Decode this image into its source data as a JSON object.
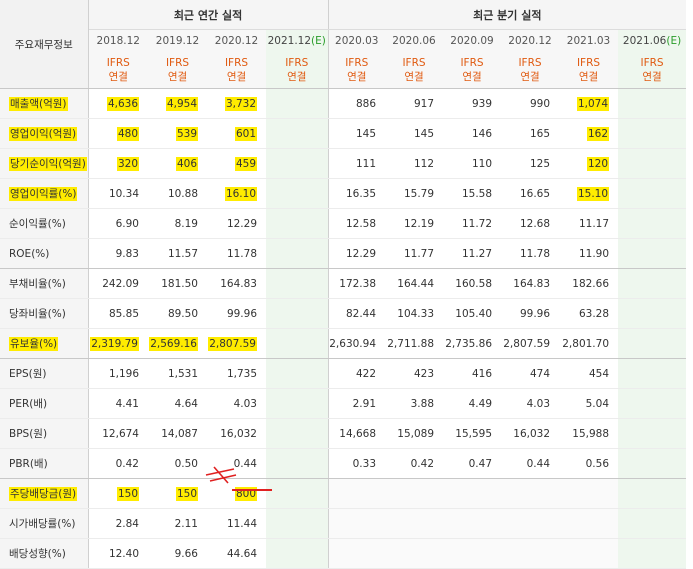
{
  "corner_label": "주요재무정보",
  "annual_header": "최근 연간 실적",
  "quarter_header": "최근 분기 실적",
  "annual_periods": [
    {
      "period": "2018.12",
      "std": "IFRS",
      "basis": "연결",
      "estimate": false
    },
    {
      "period": "2019.12",
      "std": "IFRS",
      "basis": "연결",
      "estimate": false
    },
    {
      "period": "2020.12",
      "std": "IFRS",
      "basis": "연결",
      "estimate": false
    },
    {
      "period": "2021.12",
      "est_tag": "(E)",
      "std": "IFRS",
      "basis": "연결",
      "estimate": true
    }
  ],
  "quarter_periods": [
    {
      "period": "2020.03",
      "std": "IFRS",
      "basis": "연결",
      "estimate": false
    },
    {
      "period": "2020.06",
      "std": "IFRS",
      "basis": "연결",
      "estimate": false
    },
    {
      "period": "2020.09",
      "std": "IFRS",
      "basis": "연결",
      "estimate": false
    },
    {
      "period": "2020.12",
      "std": "IFRS",
      "basis": "연결",
      "estimate": false
    },
    {
      "period": "2021.03",
      "std": "IFRS",
      "basis": "연결",
      "estimate": false
    },
    {
      "period": "2021.06",
      "est_tag": "(E)",
      "std": "IFRS",
      "basis": "연결",
      "estimate": true
    }
  ],
  "rows": [
    {
      "label": "매출액(억원)",
      "annual": [
        "4,636",
        "4,954",
        "3,732",
        ""
      ],
      "quarter": [
        "886",
        "917",
        "939",
        "990",
        "1,074",
        ""
      ],
      "hl_label": true,
      "hl_annual": [
        true,
        true,
        true,
        false
      ],
      "hl_quarter": [
        false,
        false,
        false,
        false,
        true,
        false
      ]
    },
    {
      "label": "영업이익(억원)",
      "annual": [
        "480",
        "539",
        "601",
        ""
      ],
      "quarter": [
        "145",
        "145",
        "146",
        "165",
        "162",
        ""
      ],
      "hl_label": true,
      "hl_annual": [
        true,
        true,
        true,
        false
      ],
      "hl_quarter": [
        false,
        false,
        false,
        false,
        true,
        false
      ]
    },
    {
      "label": "당기순이익(억원)",
      "annual": [
        "320",
        "406",
        "459",
        ""
      ],
      "quarter": [
        "111",
        "112",
        "110",
        "125",
        "120",
        ""
      ],
      "hl_label": true,
      "hl_annual": [
        true,
        true,
        true,
        false
      ],
      "hl_quarter": [
        false,
        false,
        false,
        false,
        true,
        false
      ]
    },
    {
      "label": "영업이익률(%)",
      "annual": [
        "10.34",
        "10.88",
        "16.10",
        ""
      ],
      "quarter": [
        "16.35",
        "15.79",
        "15.58",
        "16.65",
        "15.10",
        ""
      ],
      "hl_label": true,
      "hl_annual": [
        false,
        false,
        true,
        false
      ],
      "hl_quarter": [
        false,
        false,
        false,
        false,
        true,
        false
      ]
    },
    {
      "label": "순이익률(%)",
      "annual": [
        "6.90",
        "8.19",
        "12.29",
        ""
      ],
      "quarter": [
        "12.58",
        "12.19",
        "11.72",
        "12.68",
        "11.17",
        ""
      ]
    },
    {
      "label": "ROE(%)",
      "annual": [
        "9.83",
        "11.57",
        "11.78",
        ""
      ],
      "quarter": [
        "12.29",
        "11.77",
        "11.27",
        "11.78",
        "11.90",
        ""
      ],
      "group_end": true
    },
    {
      "label": "부채비율(%)",
      "annual": [
        "242.09",
        "181.50",
        "164.83",
        ""
      ],
      "quarter": [
        "172.38",
        "164.44",
        "160.58",
        "164.83",
        "182.66",
        ""
      ]
    },
    {
      "label": "당좌비율(%)",
      "annual": [
        "85.85",
        "89.50",
        "99.96",
        ""
      ],
      "quarter": [
        "82.44",
        "104.33",
        "105.40",
        "99.96",
        "63.28",
        ""
      ]
    },
    {
      "label": "유보율(%)",
      "annual": [
        "2,319.79",
        "2,569.16",
        "2,807.59",
        ""
      ],
      "quarter": [
        "2,630.94",
        "2,711.88",
        "2,735.86",
        "2,807.59",
        "2,801.70",
        ""
      ],
      "hl_label": true,
      "hl_annual": [
        true,
        true,
        true,
        false
      ],
      "hl_quarter": [
        false,
        false,
        false,
        false,
        false,
        false
      ],
      "group_end": true
    },
    {
      "label": "EPS(원)",
      "annual": [
        "1,196",
        "1,531",
        "1,735",
        ""
      ],
      "quarter": [
        "422",
        "423",
        "416",
        "474",
        "454",
        ""
      ]
    },
    {
      "label": "PER(배)",
      "annual": [
        "4.41",
        "4.64",
        "4.03",
        ""
      ],
      "quarter": [
        "2.91",
        "3.88",
        "4.49",
        "4.03",
        "5.04",
        ""
      ]
    },
    {
      "label": "BPS(원)",
      "annual": [
        "12,674",
        "14,087",
        "16,032",
        ""
      ],
      "quarter": [
        "14,668",
        "15,089",
        "15,595",
        "16,032",
        "15,988",
        ""
      ]
    },
    {
      "label": "PBR(배)",
      "annual": [
        "0.42",
        "0.50",
        "0.44",
        ""
      ],
      "quarter": [
        "0.33",
        "0.42",
        "0.47",
        "0.44",
        "0.56",
        ""
      ],
      "group_end": true
    },
    {
      "label": "주당배당금(원)",
      "annual": [
        "150",
        "150",
        "800",
        ""
      ],
      "quarter": [
        "",
        "",
        "",
        "",
        "",
        ""
      ],
      "hl_label": true,
      "hl_annual": [
        true,
        true,
        true,
        false
      ],
      "hl_quarter": [
        false,
        false,
        false,
        false,
        false,
        false
      ],
      "blank_quarter": true
    },
    {
      "label": "시가배당률(%)",
      "annual": [
        "2.84",
        "2.11",
        "11.44",
        ""
      ],
      "quarter": [
        "",
        "",
        "",
        "",
        "",
        ""
      ],
      "blank_quarter": true
    },
    {
      "label": "배당성향(%)",
      "annual": [
        "12.40",
        "9.66",
        "44.64",
        ""
      ],
      "quarter": [
        "",
        "",
        "",
        "",
        "",
        ""
      ],
      "blank_quarter": true
    }
  ],
  "colors": {
    "highlight": "#ffec00",
    "ifrs": "#e05a10",
    "estimate_tag": "#2a9d2a",
    "estimate_bg": "#eef7ee",
    "annotation": "#e02020"
  }
}
